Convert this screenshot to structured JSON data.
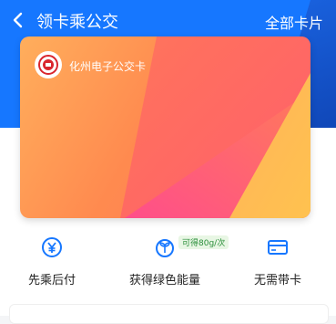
{
  "header": {
    "title": "领卡乘公交",
    "all_cards_label": "全部卡片"
  },
  "card": {
    "name": "化州电子公交卡"
  },
  "features": [
    {
      "label": "先乘后付",
      "icon": "yuan-coin-icon"
    },
    {
      "label": "获得绿色能量",
      "icon": "sprout-icon"
    },
    {
      "label": "无需带卡",
      "icon": "card-icon"
    }
  ],
  "badge": "可得80g/次",
  "colors": {
    "header_blue": "#1677ff",
    "icon_blue": "#1677ff",
    "card_orange": "#ff8a4f"
  }
}
